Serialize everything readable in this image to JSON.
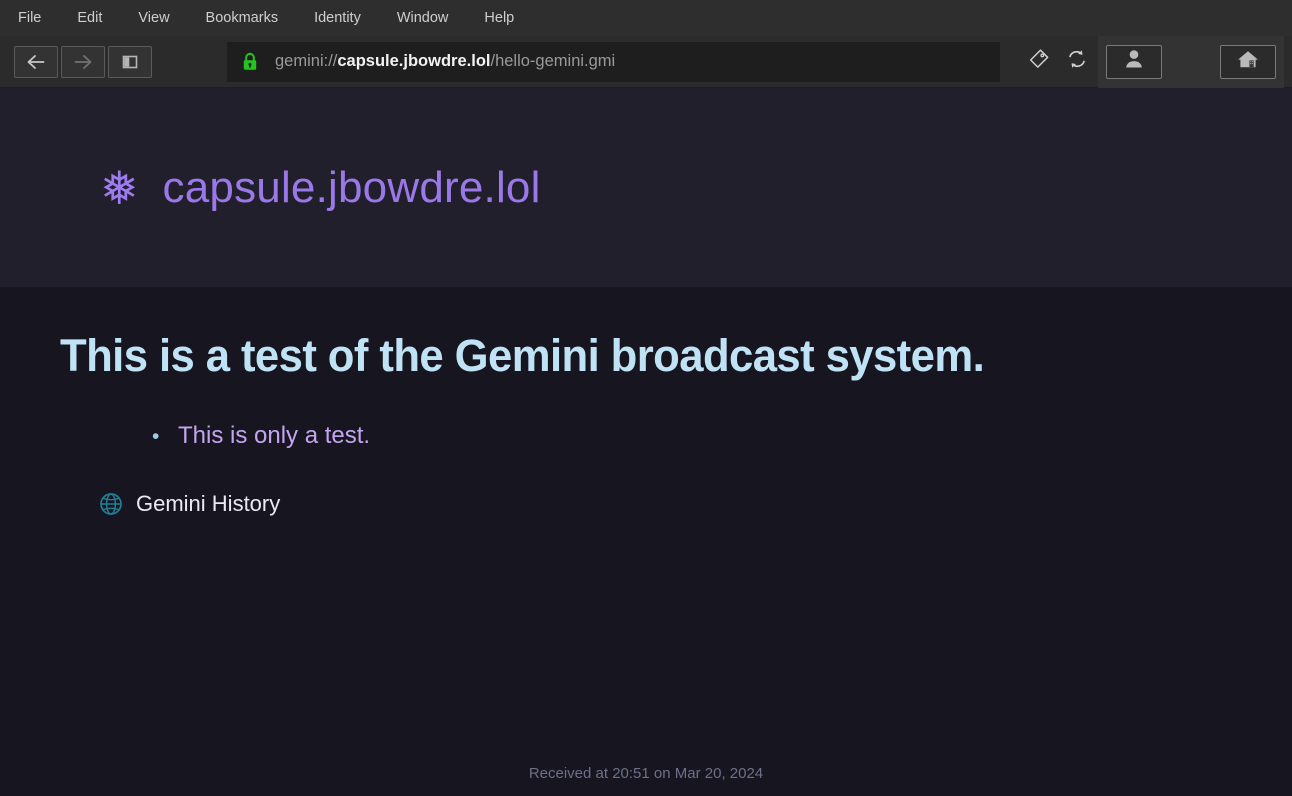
{
  "menubar": {
    "items": [
      {
        "label": "File"
      },
      {
        "label": "Edit"
      },
      {
        "label": "View"
      },
      {
        "label": "Bookmarks"
      },
      {
        "label": "Identity"
      },
      {
        "label": "Window"
      },
      {
        "label": "Help"
      }
    ]
  },
  "toolbar": {
    "back_icon": "arrow-left-icon",
    "forward_icon": "arrow-right-icon",
    "sidebar_icon": "sidebar-toggle-icon",
    "bookmark_icon": "bookmark-tag-icon",
    "reload_icon": "reload-icon",
    "identity_icon": "person-icon",
    "home_icon": "home-icon",
    "security_icon": "green-lock-icon",
    "url": {
      "scheme": "gemini://",
      "host": "capsule.jbowdre.lol",
      "path": "/hello-gemini.gmi"
    }
  },
  "banner": {
    "icon": "snowflake-icon",
    "glyph": "❅",
    "title": "capsule.jbowdre.lol",
    "accent_color": "#9a78e8"
  },
  "content": {
    "heading": "This is a test of the Gemini broadcast system.",
    "heading_color": "#bfe2f5",
    "bullet": {
      "marker": "•",
      "text": "This is only a test.",
      "text_color": "#c4a5f0"
    },
    "link": {
      "icon": "globe-icon",
      "label": "Gemini History"
    }
  },
  "footer": {
    "status": "Received at 20:51 on Mar 20, 2024"
  }
}
